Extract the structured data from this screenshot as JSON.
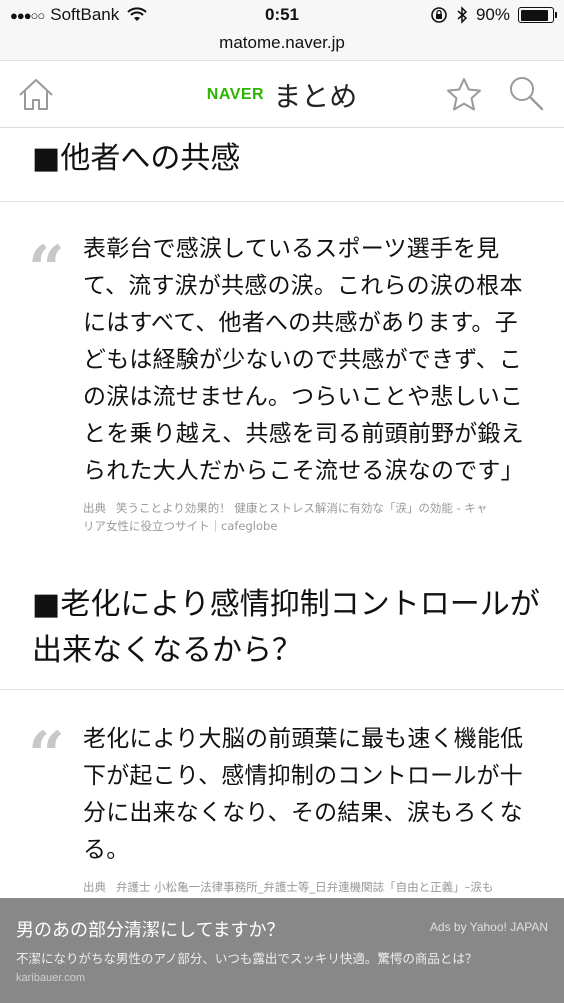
{
  "status_bar": {
    "carrier": "SoftBank",
    "time": "0:51",
    "battery": "90%",
    "battery_level": 0.9
  },
  "browser": {
    "url": "matome.naver.jp"
  },
  "header": {
    "brand": "NAVER",
    "title": "まとめ"
  },
  "sections": [
    {
      "heading": "■他者への共感",
      "quote_lines": [
        "表彰台で感涙しているスポーツ選手を見",
        "て、流す涙が共感の涙。これらの涙の根本",
        "にはすべて、他者への共感があります。子",
        "どもは経験が少ないので共感ができず、こ",
        "の涙は流せません。つらいことや悲しいこ",
        "とを乗り越え、共感を司る前頭前野が鍛え",
        "られた大人だからこそ流せる涙なのです」"
      ],
      "source_label": "出典",
      "source_lines": [
        "笑うことより効果的！ 健康とストレス解消に有効な「涙」の効能 - キャ",
        "リア女性に役立つサイト｜cafeglobe"
      ]
    },
    {
      "heading_lines": [
        "■老化により感情抑制コントロールが",
        "出来なくなるから？"
      ],
      "quote_lines": [
        "老化により大脳の前頭葉に最も速く機能低",
        "下が起こり、感情抑制のコントロールが十",
        "分に出来なくなり、その結果、涙もろくな",
        "る。"
      ],
      "source_label": "出典",
      "source_lines": [
        "弁護士 小松亀一法律事務所_弁護士等_日弁連機関誌「自由と正義」–涙も"
      ]
    }
  ],
  "ad": {
    "title": "男のあの部分清潔にしてますか？",
    "provider": "Ads by Yahoo! JAPAN",
    "description": "不潔になりがちな男性のアノ部分、いつも露出でスッキリ快適。驚愕の商品とは？",
    "domain": "karibauer.com"
  }
}
